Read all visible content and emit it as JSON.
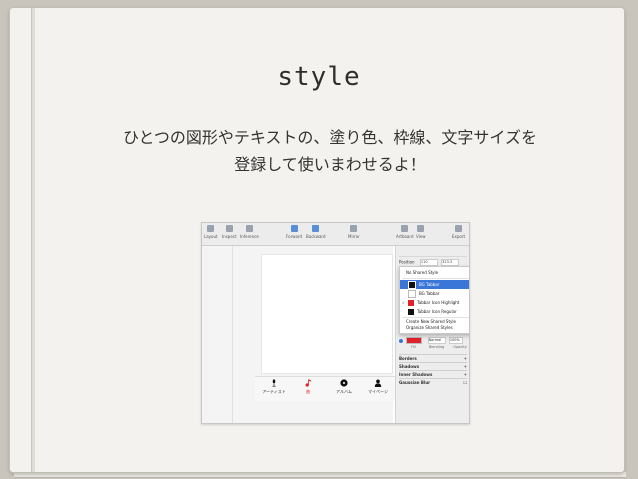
{
  "slide": {
    "title": "style",
    "subtitle_line1": "ひとつの図形やテキストの、塗り色、枠線、文字サイズを",
    "subtitle_line2": "登録して使いまわせるよ！"
  },
  "screenshot": {
    "toolbar": {
      "items": [
        "Layout",
        "Inspect",
        "Inference",
        "Forward",
        "Backward",
        "Mirror",
        "Artboard",
        "View",
        "Export"
      ]
    },
    "tabbar": {
      "tabs": [
        "アーティスト",
        "曲",
        "アルバム",
        "マイページ"
      ],
      "active_color": "#e0202a"
    },
    "inspector": {
      "position_label": "Position",
      "position_x": "110",
      "position_y": "323.3",
      "fill_label": "Fill",
      "blending_label": "Blending",
      "blending_value": "Normal",
      "opacity_label": "Opacity",
      "opacity_value": "100%",
      "sections": [
        "Borders",
        "Shadows",
        "Inner Shadows",
        "Gaussian Blur"
      ]
    },
    "shared_style_menu": {
      "items": [
        {
          "label": "No Shared Style",
          "swatch": null,
          "selected": false,
          "checked": false
        },
        {
          "label": "BG Tabbar",
          "swatch": "#111111",
          "selected": true,
          "checked": false
        },
        {
          "label": "BG Tabbar",
          "swatch": "#ffffff",
          "selected": false,
          "checked": false
        },
        {
          "label": "Tabbar Icon Highlight",
          "swatch": "#e0202a",
          "selected": false,
          "checked": true
        },
        {
          "label": "Tabbar Icon Regular",
          "swatch": "#111111",
          "selected": false,
          "checked": false
        }
      ],
      "actions": [
        "Create New Shared Style",
        "Organize Shared Styles"
      ]
    }
  }
}
